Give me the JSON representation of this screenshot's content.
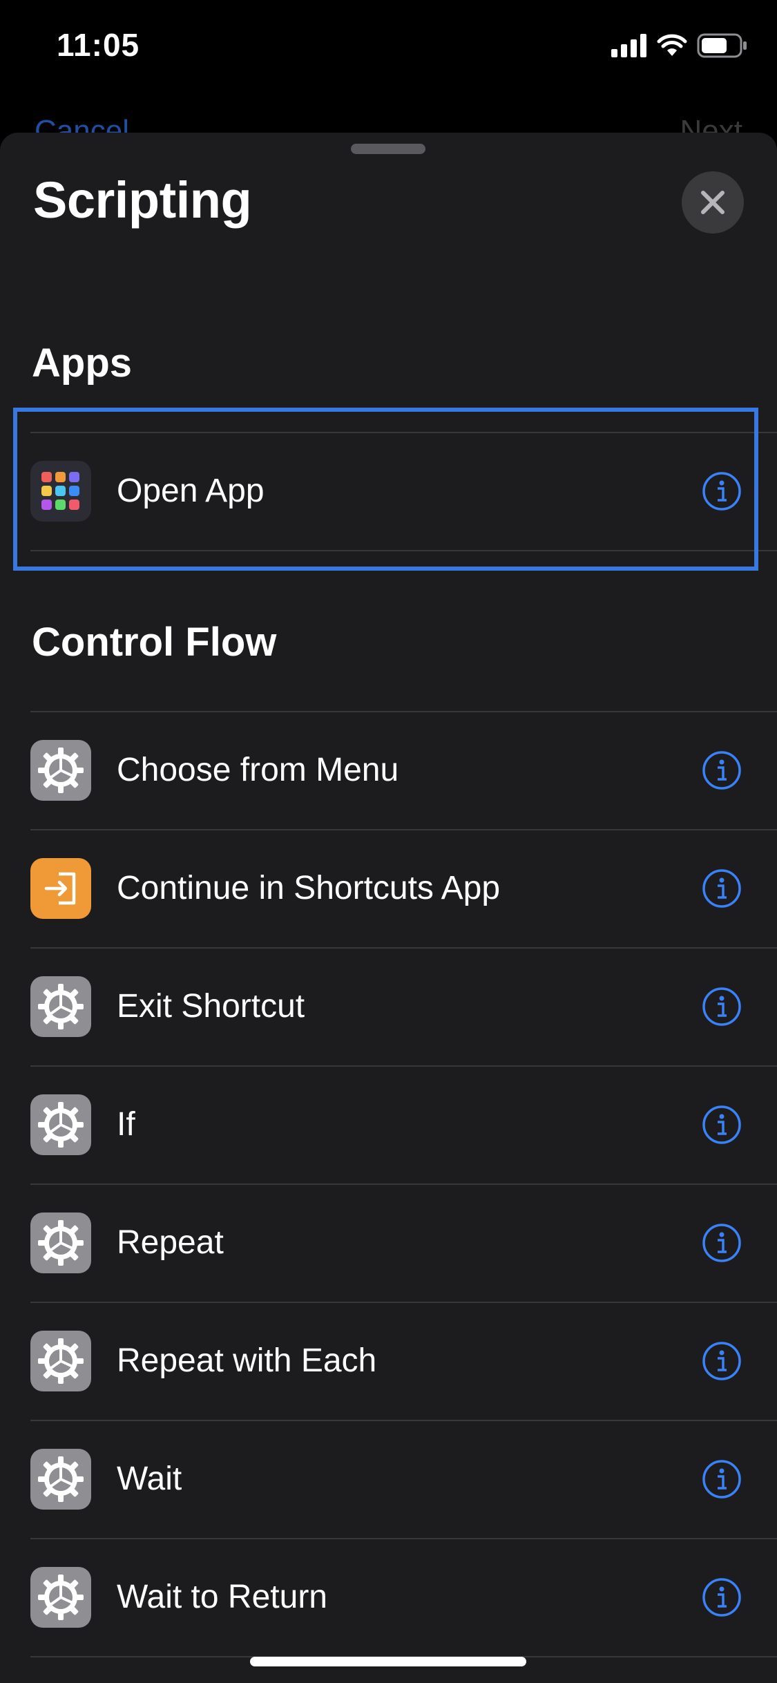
{
  "status_bar": {
    "time": "11:05"
  },
  "behind": {
    "left_label": "Cancel",
    "right_label": "Next"
  },
  "sheet": {
    "title": "Scripting"
  },
  "sections": [
    {
      "header": "Apps",
      "items": [
        {
          "label": "Open App",
          "icon": "app-grid-icon"
        }
      ]
    },
    {
      "header": "Control Flow",
      "items": [
        {
          "label": "Choose from Menu",
          "icon": "gear-icon"
        },
        {
          "label": "Continue in Shortcuts App",
          "icon": "enter-arrow-icon"
        },
        {
          "label": "Exit Shortcut",
          "icon": "gear-icon"
        },
        {
          "label": "If",
          "icon": "gear-icon"
        },
        {
          "label": "Repeat",
          "icon": "gear-icon"
        },
        {
          "label": "Repeat with Each",
          "icon": "gear-icon"
        },
        {
          "label": "Wait",
          "icon": "gear-icon"
        },
        {
          "label": "Wait to Return",
          "icon": "gear-icon"
        }
      ]
    }
  ],
  "colors": {
    "accent": "#3a82f7",
    "highlight": "#3878e0",
    "sheet_bg": "#1c1c1e",
    "gear_bg": "#8e8e93",
    "orange_bg": "#f09a37"
  }
}
